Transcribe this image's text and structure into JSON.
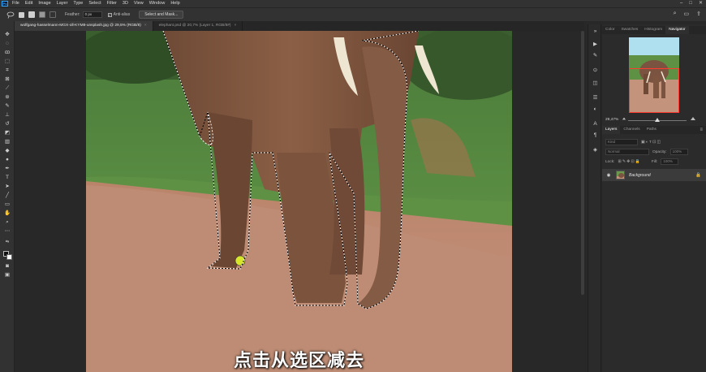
{
  "app": {
    "logo": "Ps"
  },
  "menu": [
    "File",
    "Edit",
    "Image",
    "Layer",
    "Type",
    "Select",
    "Filter",
    "3D",
    "View",
    "Window",
    "Help"
  ],
  "window_controls": {
    "minimize": "–",
    "restore": "□",
    "close": "✕"
  },
  "options": {
    "feather_label": "Feather:",
    "feather_value": "0 px",
    "anti_alias_label": "Anti-alias",
    "anti_alias_checked": "✓",
    "select_mask_label": "Select and Mask...",
    "icons": [
      "lasso-tool-icon",
      "new-selection-icon",
      "add-selection-icon",
      "subtract-selection-icon",
      "intersect-selection-icon"
    ]
  },
  "doc_tabs": [
    {
      "label": "wolfgang-hasselmann-MGX-oll-KYM8-unsplash.jpg @ 29,5% (RGB/8)",
      "close": "×",
      "active": true
    },
    {
      "label": "elephant.psd @ 20,7% (Layer 1, RGB/8#)",
      "close": "×",
      "active": false
    }
  ],
  "canvas": {
    "subtitle": "点击从选区减去"
  },
  "panels": {
    "top_tabs": [
      "Color",
      "Swatches",
      "Histogram",
      "Navigator"
    ],
    "top_active": "Navigator",
    "zoom": "29,47%",
    "layer_tabs": [
      "Layers",
      "Channels",
      "Paths"
    ],
    "layer_active": "Layers",
    "filter_placeholder": "Kind",
    "blend_mode": "Normal",
    "opacity_label": "Opacity:",
    "opacity_value": "100%",
    "lock_label": "Lock:",
    "fill_label": "Fill:",
    "fill_value": "100%",
    "layers": [
      {
        "name": "Background",
        "visible": true,
        "locked": true
      }
    ]
  },
  "colors": {
    "accent_selection": "#ff3b30",
    "panel_bg": "#2b2b2b",
    "chrome_bg": "#323232"
  }
}
